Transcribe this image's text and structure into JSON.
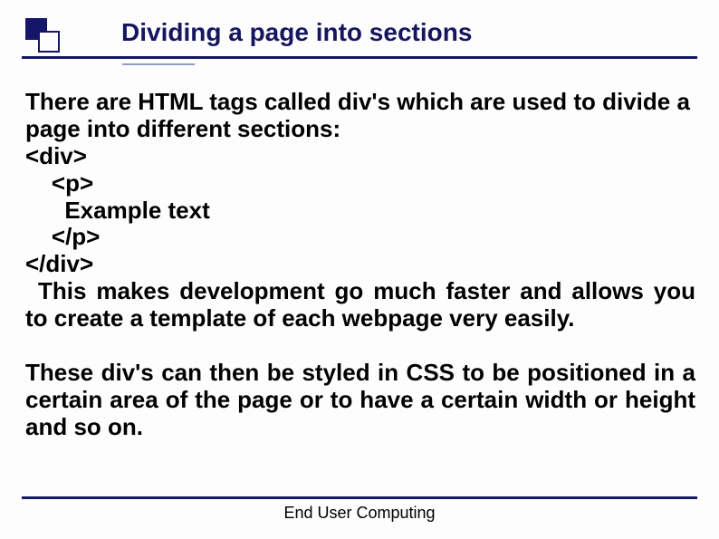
{
  "title": "Dividing a page into sections",
  "intro": " There are HTML tags called div's which are used to divide a page into different sections:",
  "code": {
    "l1": "<div>",
    "l2": "    <p>",
    "l3": "      Example text",
    "l4": "    </p>",
    "l5": "</div>"
  },
  "after_code": "This makes development go much faster and allows you to create a template of each webpage very easily.",
  "para2": "These div's can then be styled in CSS to be positioned in a certain area of the page or to have a certain width or height and so on.",
  "footer": "End User Computing"
}
